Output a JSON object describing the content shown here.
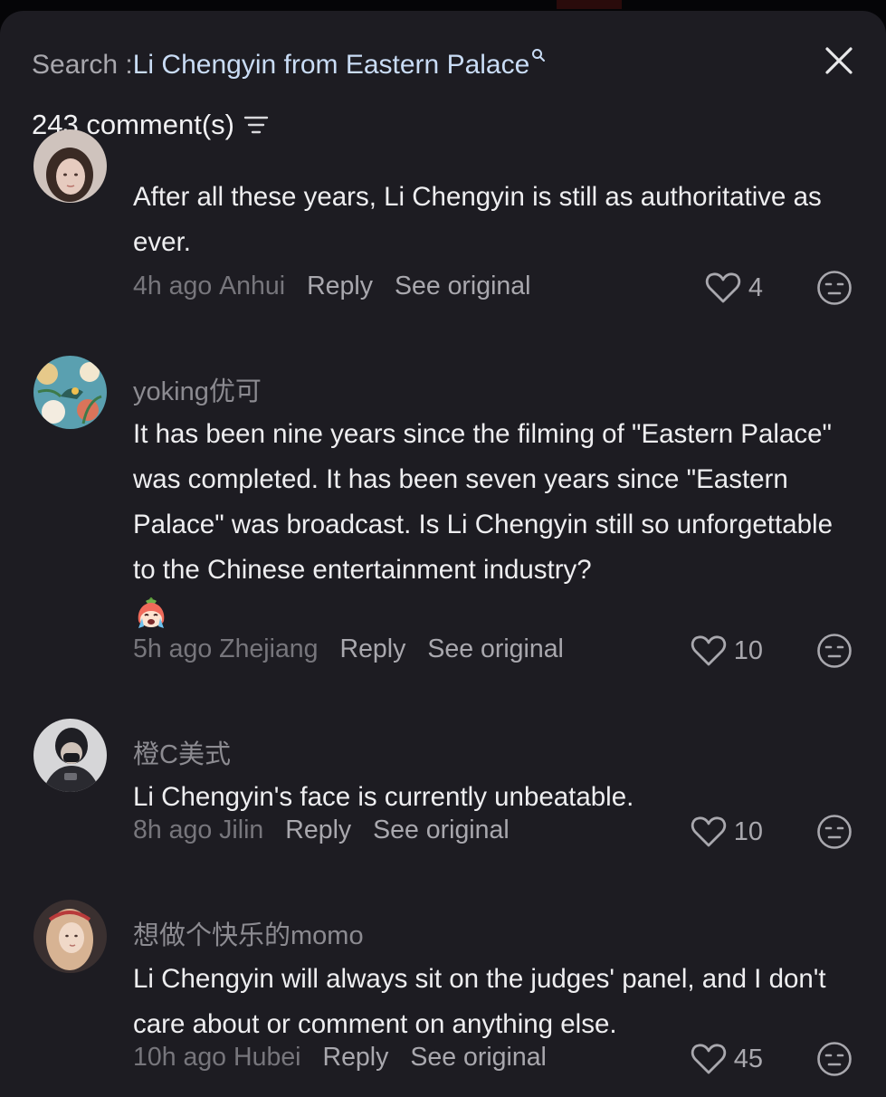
{
  "search": {
    "prefix": "Search : ",
    "query": "Li Chengyin from Eastern Palace"
  },
  "header": {
    "comment_count": "243 comment(s)"
  },
  "comments": [
    {
      "username": "",
      "text": "After all these years, Li Chengyin is still as authoritative as ever.",
      "time": "4h ago",
      "location": "Anhui",
      "reply_label": "Reply",
      "see_original_label": "See original",
      "likes": "4"
    },
    {
      "username": "yoking优可",
      "text": "It has been nine years since the filming of \"Eastern Palace\" was completed. It has been seven years since \"Eastern Palace\" was broadcast. Is Li Chengyin still so unforgettable to the Chinese entertainment industry?",
      "emoji": "crying-face-emoji",
      "time": "5h ago",
      "location": "Zhejiang",
      "reply_label": "Reply",
      "see_original_label": "See original",
      "likes": "10"
    },
    {
      "username": "橙C美式",
      "text": "Li Chengyin's face is currently unbeatable.",
      "time": "8h ago",
      "location": "Jilin",
      "reply_label": "Reply",
      "see_original_label": "See original",
      "likes": "10"
    },
    {
      "username": "想做个快乐的momo",
      "text": "Li Chengyin will always sit on the judges' panel, and I don't care about or comment on anything else.",
      "time": "10h ago",
      "location": "Hubei",
      "reply_label": "Reply",
      "see_original_label": "See original",
      "likes": "45"
    }
  ],
  "icons": {
    "close": "close-icon",
    "sort": "sort-icon",
    "like": "heart-icon",
    "dislike": "neutral-face-icon",
    "search": "search-icon"
  },
  "colors": {
    "background": "#1d1c22",
    "query": "#c9dcf5",
    "text": "#eeeef0",
    "muted": "#77767c",
    "action": "#a9a8ae"
  }
}
